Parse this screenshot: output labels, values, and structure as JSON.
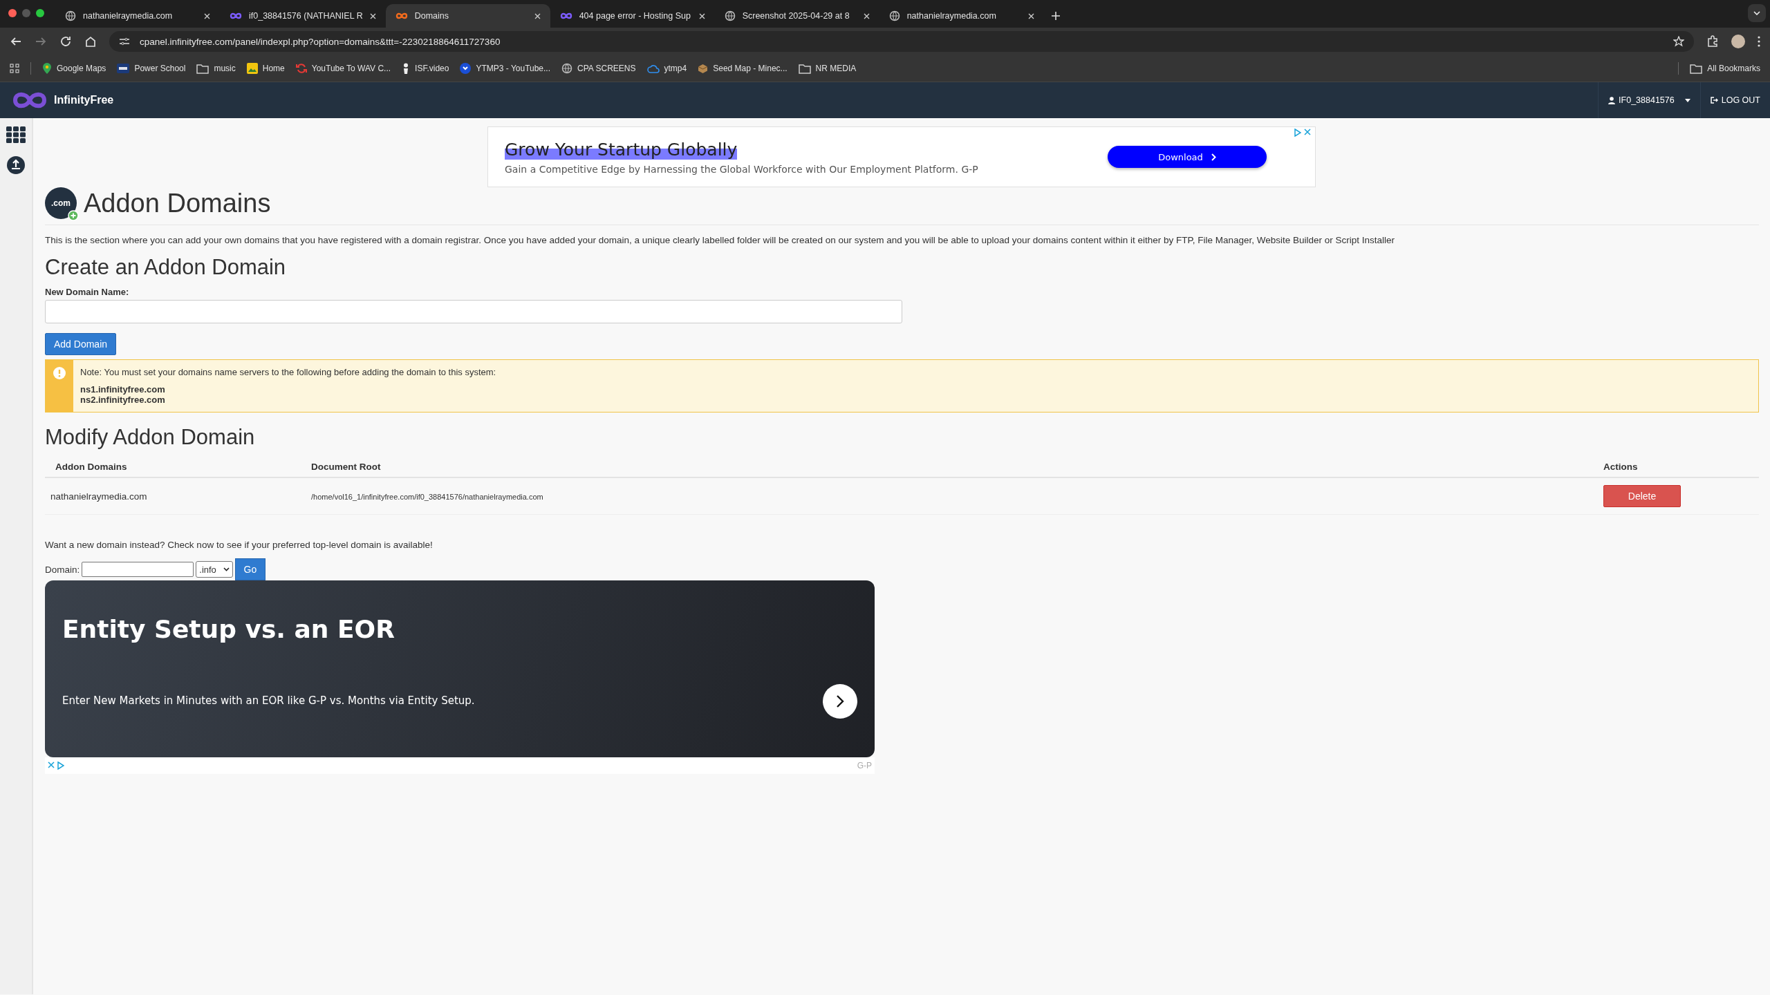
{
  "browser": {
    "tabs": [
      {
        "title": "nathanielraymedia.com",
        "kind": "globe",
        "selected": false
      },
      {
        "title": "if0_38841576 (NATHANIEL R",
        "kind": "infinity",
        "selected": false
      },
      {
        "title": "Domains",
        "kind": "infinity",
        "selected": true
      },
      {
        "title": "404 page error - Hosting Sup",
        "kind": "infinity",
        "selected": false
      },
      {
        "title": "Screenshot 2025-04-29 at 8",
        "kind": "globe",
        "selected": false
      },
      {
        "title": "nathanielraymedia.com",
        "kind": "globe",
        "selected": false
      }
    ],
    "url": "cpanel.infinityfree.com/panel/indexpl.php?option=domains&ttt=-2230218864611727360",
    "bookmarks": [
      {
        "label": "Google Maps",
        "kind": "pin"
      },
      {
        "label": "Power School",
        "kind": "badge"
      },
      {
        "label": "music",
        "kind": "folder"
      },
      {
        "label": "Home",
        "kind": "image"
      },
      {
        "label": "YouTube To WAV C...",
        "kind": "sync"
      },
      {
        "label": "ISF.video",
        "kind": "figure"
      },
      {
        "label": "YTMP3 - YouTube...",
        "kind": "circle"
      },
      {
        "label": "CPA SCREENS",
        "kind": "globe"
      },
      {
        "label": "ytmp4",
        "kind": "cloud"
      },
      {
        "label": "Seed Map - Minec...",
        "kind": "block"
      },
      {
        "label": "NR MEDIA",
        "kind": "folder"
      }
    ],
    "all_bookmarks": "All Bookmarks"
  },
  "header": {
    "brand": "InfinityFree",
    "user": "IF0_38841576",
    "logout": "LOG OUT"
  },
  "ad_banner": {
    "headline": "Grow Your Startup Globally",
    "subline": "Gain a Competitive Edge by Harnessing the Global Workforce with Our Employment Platform. G-P",
    "button": "Download"
  },
  "page": {
    "icon_text": ".com",
    "title": "Addon Domains",
    "description": "This is the section where you can add your own domains that you have registered with a domain registrar. Once you have added your domain, a unique clearly labelled folder will be created on our system and you will be able to upload your domains content within it either by FTP, File Manager, Website Builder or Script Installer",
    "create_heading": "Create an Addon Domain",
    "field_label": "New Domain Name:",
    "add_button": "Add Domain",
    "note": {
      "text": "Note: You must set your domains name servers to the following before adding the domain to this system:",
      "servers": [
        "ns1.infinityfree.com",
        "ns2.infinityfree.com"
      ]
    },
    "modify_heading": "Modify Addon Domain",
    "table": {
      "columns": [
        "Addon Domains",
        "Document Root",
        "Actions"
      ],
      "rows": [
        {
          "domain": "nathanielraymedia.com",
          "root": "/home/vol16_1/infinityfree.com/if0_38841576/nathanielraymedia.com",
          "action": "Delete"
        }
      ]
    },
    "domain_search": {
      "prompt": "Want a new domain instead? Check now to see if your preferred top-level domain is available!",
      "label": "Domain:",
      "tld": ".info",
      "go": "Go"
    }
  },
  "ad_card": {
    "headline": "Entity Setup vs. an EOR",
    "text": "Enter New Markets in Minutes with an EOR like G-P vs. Months via Entity Setup.",
    "source": "G-P"
  }
}
